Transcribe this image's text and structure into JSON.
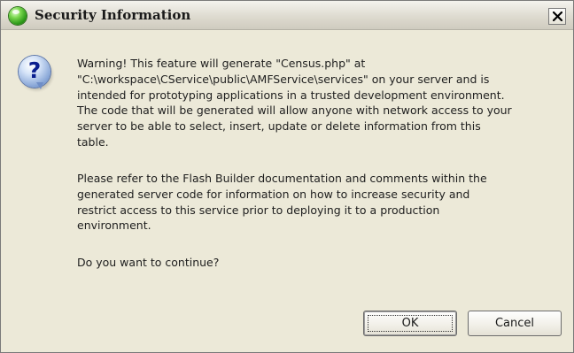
{
  "window": {
    "title": "Security Information",
    "icons": {
      "app": "green-orb-icon",
      "close": "close-icon",
      "message": "question-icon"
    }
  },
  "message": {
    "icon_glyph": "?",
    "paragraph1": [
      "Warning!  This feature will generate \"Census.php\" at",
      "\"C:\\workspace\\CService\\public\\AMFService\\services\" on your server and is",
      "intended for prototyping applications in a trusted development environment.",
      "The code that will be generated will allow anyone with network access to your",
      "server to be able to select, insert, update or delete information from this",
      "table."
    ],
    "paragraph2": [
      "Please refer to the Flash Builder documentation and comments within the",
      "generated server code for information on how to increase security and",
      "restrict access to this service prior to deploying it to a production",
      "environment."
    ],
    "question": "Do you want to continue?"
  },
  "buttons": {
    "ok_label": "OK",
    "cancel_label": "Cancel"
  }
}
